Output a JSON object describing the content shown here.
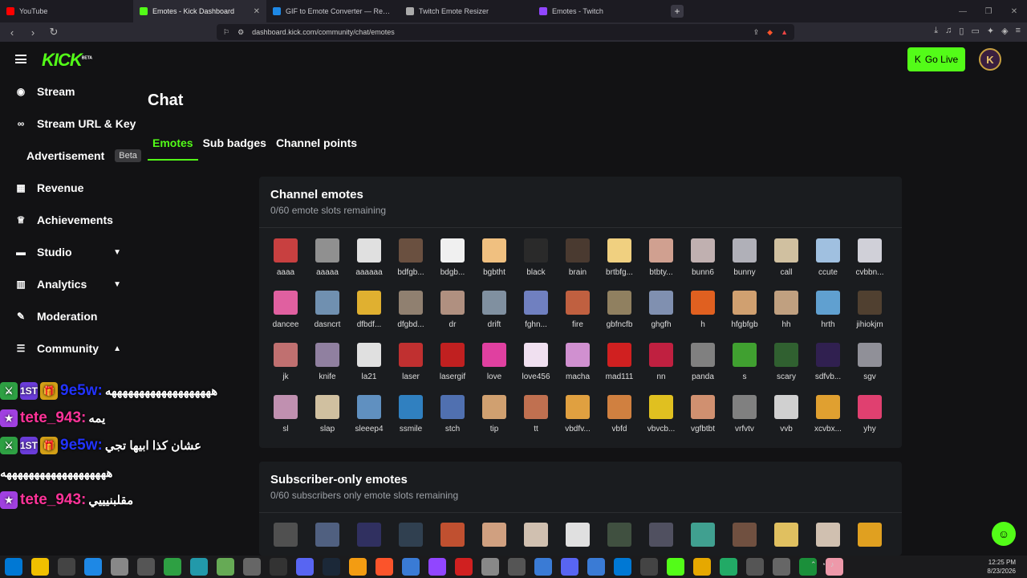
{
  "browser": {
    "tabs": [
      {
        "title": "YouTube",
        "color": "#ff0000"
      },
      {
        "title": "Emotes - Kick Dashboard",
        "color": "#53fc18"
      },
      {
        "title": "GIF to Emote Converter — Resize for Twitch & Discord",
        "color": "#1e88e5"
      },
      {
        "title": "Twitch Emote Resizer",
        "color": "#aaaaaa"
      },
      {
        "title": "Emotes - Twitch",
        "color": "#9146ff"
      }
    ],
    "url": "dashboard.kick.com/community/chat/emotes"
  },
  "header": {
    "logo": "KICK",
    "logo_badge": "BETA",
    "go_live": "Go Live",
    "avatar": "K"
  },
  "sidebar": {
    "items": [
      {
        "label": "Stream",
        "icon": "broadcast-icon",
        "glyph": "◉"
      },
      {
        "label": "Stream URL & Key",
        "icon": "link-icon",
        "glyph": "∞"
      },
      {
        "label": "Advertisement",
        "badge": "Beta"
      },
      {
        "label": "Revenue",
        "icon": "revenue-icon",
        "glyph": "▦"
      },
      {
        "label": "Achievements",
        "icon": "trophy-icon",
        "glyph": "♕"
      },
      {
        "label": "Studio",
        "icon": "studio-icon",
        "glyph": "▬",
        "chev": "▼"
      },
      {
        "label": "Analytics",
        "icon": "analytics-icon",
        "glyph": "▥",
        "chev": "▼"
      },
      {
        "label": "Moderation",
        "icon": "wrench-icon",
        "glyph": "✎"
      },
      {
        "label": "Community",
        "icon": "community-icon",
        "glyph": "☰",
        "chev": "▲"
      }
    ]
  },
  "page": {
    "title": "Chat"
  },
  "content_tabs": [
    "Emotes",
    "Sub badges",
    "Channel points"
  ],
  "channel_panel": {
    "title": "Channel emotes",
    "subtitle": "0/60 emote slots remaining",
    "emotes": [
      "aaaa",
      "aaaaa",
      "aaaaaa",
      "bdfgb...",
      "bdgb...",
      "bgbtht",
      "black",
      "brain",
      "brtbfg...",
      "btbty...",
      "bunn6",
      "bunny",
      "call",
      "ccute",
      "cvbbn...",
      "dancee",
      "dasncrt",
      "dfbdf...",
      "dfgbd...",
      "dr",
      "drift",
      "fghn...",
      "fire",
      "gbfncfb",
      "ghgfh",
      "h",
      "hfgbfgb",
      "hh",
      "hrth",
      "jihiokjm",
      "jk",
      "knife",
      "la21",
      "laser",
      "lasergif",
      "love",
      "love456",
      "macha",
      "mad111",
      "nn",
      "panda",
      "s",
      "scary",
      "sdfvb...",
      "sgv",
      "sl",
      "slap",
      "sleeep4",
      "ssmile",
      "stch",
      "tip",
      "tt",
      "vbdfv...",
      "vbfd",
      "vbvcb...",
      "vgfbtbt",
      "vrfvtv",
      "vvb",
      "xcvbx...",
      "yhy"
    ],
    "colors": [
      "#c84040",
      "#909090",
      "#e0e0e0",
      "#6a5040",
      "#f0f0f0",
      "#f0c080",
      "#2a2a2a",
      "#4a3a30",
      "#f0d080",
      "#d0a090",
      "#c0b0b0",
      "#b0b0b8",
      "#d0c0a0",
      "#a0c0e0",
      "#d0d0d8",
      "#e060a0",
      "#7090b0",
      "#e0b030",
      "#908070",
      "#b09080",
      "#8090a0",
      "#7080c0",
      "#c06040",
      "#908060",
      "#8090b0",
      "#e06020",
      "#d0a070",
      "#c0a080",
      "#60a0d0",
      "#504030",
      "#c07070",
      "#9080a0",
      "#e0e0e0",
      "#c03030",
      "#c02020",
      "#e040a0",
      "#f0e0f0",
      "#d090d0",
      "#d02020",
      "#c02040",
      "#808080",
      "#40a030",
      "#306030",
      "#302050",
      "#909098",
      "#c090b0",
      "#d0c0a0",
      "#6090c0",
      "#3080c0",
      "#5070b0",
      "#d0a070",
      "#c07050",
      "#e0a040",
      "#d08040",
      "#e0c020",
      "#d09070",
      "#808080",
      "#d0d0d0",
      "#e0a030",
      "#e04070"
    ]
  },
  "subscriber_panel": {
    "title": "Subscriber-only emotes",
    "subtitle": "0/60 subscribers only emote slots remaining",
    "colors": [
      "#505050",
      "#506080",
      "#303060",
      "#304050",
      "#c05030",
      "#d0a080",
      "#d0c0b0",
      "#e0e0e0",
      "#405040",
      "#505060",
      "#40a090",
      "#705040",
      "#e0c060",
      "#d0c0b0",
      "#e0a020"
    ]
  },
  "chat_overlay": {
    "lines": [
      {
        "user": "9e5w:",
        "msg": "هههههههههههههههههههه",
        "badges": [
          "⚔",
          "1ST",
          "🎁"
        ]
      },
      {
        "user": "tete_943:",
        "msg": "يمه",
        "badges": [
          "★"
        ]
      },
      {
        "user": "9e5w:",
        "msg": "عشان كذا ابيها تجي",
        "badges": [
          "⚔",
          "1ST",
          "🎁"
        ]
      },
      {
        "user": "",
        "msg": "هههههههههههههههههههه",
        "badges": []
      },
      {
        "user": "tete_943:",
        "msg": "مقلبنيييي",
        "badges": [
          "★"
        ]
      }
    ]
  },
  "taskbar": {
    "time": "12:25 PM",
    "date": "8/23/2026"
  }
}
